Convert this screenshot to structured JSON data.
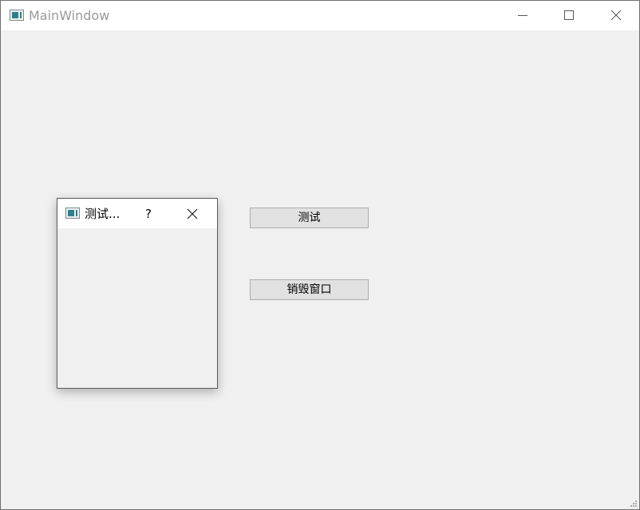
{
  "main_window": {
    "title": "MainWindow",
    "icons": {
      "app": "window-app-icon",
      "minimize": "minimize-icon",
      "maximize": "maximize-icon",
      "close": "close-icon",
      "resize_grip": "resize-grip-icon"
    }
  },
  "buttons": {
    "test_label": "测试",
    "destroy_label": "销毁窗口"
  },
  "dialog": {
    "title": "测试...",
    "help_label": "?",
    "icons": {
      "app": "window-app-icon",
      "close": "close-icon"
    }
  },
  "colors": {
    "titlebar_bg": "#ffffff",
    "client_bg": "#f0f0f0",
    "button_bg": "#e1e1e1",
    "button_border": "#adadad",
    "title_text_inactive": "#999999"
  }
}
